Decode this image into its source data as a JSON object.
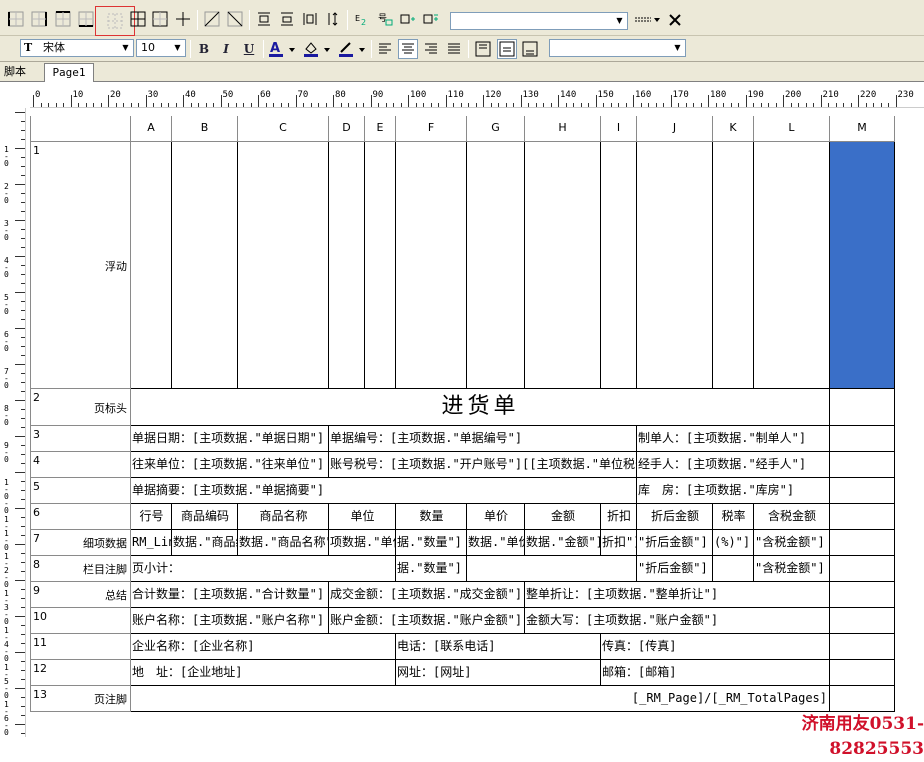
{
  "toolbar2": {
    "font_name": "宋体",
    "font_size": "10",
    "bold": "B",
    "italic": "I",
    "underline": "U"
  },
  "tabs": {
    "script": "脚本",
    "page1": "Page1"
  },
  "ruler_labels": [
    "0",
    "10",
    "20",
    "30",
    "40",
    "50",
    "60",
    "70",
    "80",
    "90",
    "100",
    "110",
    "120",
    "130",
    "140",
    "150",
    "160",
    "170",
    "180",
    "190",
    "200",
    "210",
    "220",
    "230"
  ],
  "vruler_labels": [
    "1-0",
    "2-0",
    "3-0",
    "4-0",
    "5-0",
    "6-0",
    "7-0",
    "8-0",
    "9-0",
    "1-0-0",
    "1-1-0",
    "1-2-0",
    "1-3-0",
    "1-4-0",
    "1-5-0",
    "1-6-0"
  ],
  "columns": [
    "A",
    "B",
    "C",
    "D",
    "E",
    "F",
    "G",
    "H",
    "I",
    "J",
    "K",
    "L",
    "M"
  ],
  "rows": [
    {
      "num": "1",
      "label": "浮动"
    },
    {
      "num": "2",
      "label": "页标头"
    },
    {
      "num": "3",
      "label": ""
    },
    {
      "num": "4",
      "label": ""
    },
    {
      "num": "5",
      "label": ""
    },
    {
      "num": "6",
      "label": ""
    },
    {
      "num": "7",
      "label": "细项数据"
    },
    {
      "num": "8",
      "label": "栏目注脚"
    },
    {
      "num": "9",
      "label": "总结"
    },
    {
      "num": "10",
      "label": ""
    },
    {
      "num": "11",
      "label": ""
    },
    {
      "num": "12",
      "label": ""
    },
    {
      "num": "13",
      "label": "页注脚"
    }
  ],
  "cells": {
    "title": "进货单",
    "r3a": "单据日期：[主项数据.\"单据日期\"]",
    "r3b": "单据编号：[主项数据.\"单据编号\"]",
    "r3c": "制单人：[主项数据.\"制单人\"]",
    "r4a": "往来单位：[主项数据.\"往来单位\"]",
    "r4b": "账号税号：[主项数据.\"开户账号\"][[主项数据.\"单位税号\"]",
    "r4c": "经手人：[主项数据.\"经手人\"]",
    "r5a": "单据摘要：[主项数据.\"单据摘要\"]",
    "r5c": "库　房：[主项数据.\"库房\"]",
    "h6": [
      "行号",
      "商品编码",
      "商品名称",
      "单位",
      "数量",
      "单价",
      "金额",
      "折扣",
      "折后金额",
      "税率",
      "含税金额"
    ],
    "r7": [
      "RM_Lin",
      "数据.\"商品编码\"",
      "数据.\"商品名称\"",
      "项数据.\"单位\"",
      "据.\"数量\"]",
      "数据.\"单价\"",
      "数据.\"金额\"]",
      "折扣\"]",
      "\"折后金额\"]",
      "(%)\"]",
      "\"含税金额\"]"
    ],
    "r8a": "页小计：",
    "r8f": "据.\"数量\"]",
    "r8j": "\"折后金额\"]",
    "r8l": "\"含税金额\"]",
    "r9a": "合计数量：[主项数据.\"合计数量\"]",
    "r9d": "成交金额：[主项数据.\"成交金额\"]",
    "r9h": "整单折让：[主项数据.\"整单折让\"]",
    "r10a": "账户名称：[主项数据.\"账户名称\"]",
    "r10d": "账户金额：[主项数据.\"账户金额\"]",
    "r10h": "金额大写：[主项数据.\"账户金额\"]",
    "r11a": "企业名称：[企业名称]",
    "r11f": "电话：[联系电话]",
    "r11i": "传真：[传真]",
    "r12a": "地　址：[企业地址]",
    "r12f": "网址：[网址]",
    "r12i": "邮箱：[邮箱]",
    "r13": "[_RM_Page]/[_RM_TotalPages]"
  },
  "watermark": "济南用友0531-82825553",
  "colors": {
    "highlight": "#3a6fc8",
    "watermark": "#d0102a",
    "toolbar": "#ece9d8"
  }
}
